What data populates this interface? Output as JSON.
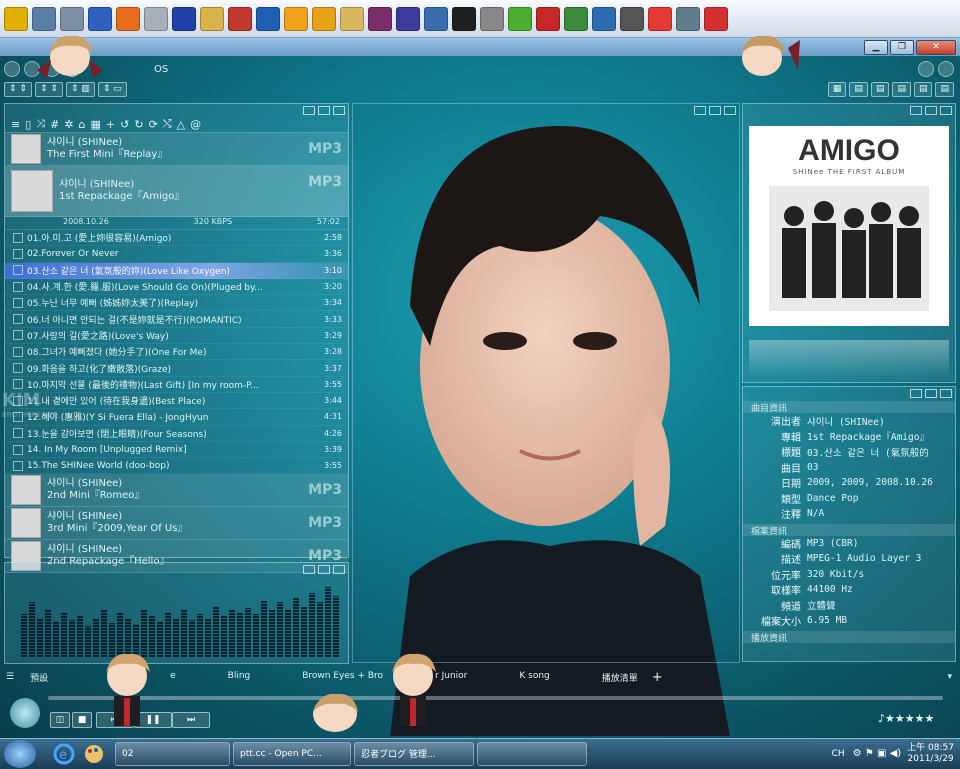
{
  "launcher": {
    "icons": [
      {
        "name": "ptt-icon",
        "color": "#e2b000"
      },
      {
        "name": "notepad-icon",
        "color": "#5a7fa6"
      },
      {
        "name": "tool-icon",
        "color": "#7d8fa4"
      },
      {
        "name": "calendar-icon",
        "color": "#2f5fbf"
      },
      {
        "name": "firefox-icon",
        "color": "#e86c1a"
      },
      {
        "name": "alien-icon",
        "color": "#a8b0b8"
      },
      {
        "name": "music-icon",
        "color": "#2340a8"
      },
      {
        "name": "paint-icon",
        "color": "#d9b24a"
      },
      {
        "name": "calendar25-icon",
        "color": "#c0392b"
      },
      {
        "name": "virtualbox-icon",
        "color": "#1f5fb4"
      },
      {
        "name": "moon-icon",
        "color": "#f0a31a"
      },
      {
        "name": "flashget-icon",
        "color": "#e8a317"
      },
      {
        "name": "folder-icon",
        "color": "#d8b75e"
      },
      {
        "name": "winrar-icon",
        "color": "#7b2d6a"
      },
      {
        "name": "player-icon",
        "color": "#3e3a9c"
      },
      {
        "name": "calculator-icon",
        "color": "#3a6db0"
      },
      {
        "name": "7zip-icon",
        "color": "#1f1f1f"
      },
      {
        "name": "edit-icon",
        "color": "#888888"
      },
      {
        "name": "heart-icon",
        "color": "#4caf2f"
      },
      {
        "name": "stop-icon",
        "color": "#c62828"
      },
      {
        "name": "clock-icon",
        "color": "#3d8b3d"
      },
      {
        "name": "transfer-icon",
        "color": "#2b6cb0"
      },
      {
        "name": "film-icon",
        "color": "#555555"
      },
      {
        "name": "color-icon",
        "color": "#e53935"
      },
      {
        "name": "drive-icon",
        "color": "#607d8b"
      },
      {
        "name": "eraser-icon",
        "color": "#d32f2f"
      }
    ]
  },
  "window": {
    "minimize": "▁",
    "restore": "❐",
    "close": "✕"
  },
  "player": {
    "menu_text": "OS"
  },
  "playlist": {
    "albums_top": [
      {
        "artist": "샤이니 (SHINee)",
        "title": "The First Mini『Replay』",
        "format": "MP3"
      }
    ],
    "current_album": {
      "artist": "샤이니 (SHINee)",
      "title": "1st Repackage『Amigo』",
      "format": "MP3",
      "date": "2008.10.26",
      "bitrate": "320 KBPS",
      "total": "57:02"
    },
    "tracks": [
      {
        "name": "01.아.미.고 (愛上妳很容易)(Amigo)",
        "dur": "2:58"
      },
      {
        "name": "02.Forever Or Never",
        "dur": "3:36"
      },
      {
        "name": "03.산소 같은 너 (氣氛般的妳)(Love Like Oxygen)",
        "dur": "3:10",
        "selected": true
      },
      {
        "name": "04.사.계.한 (愛.羅.服)(Love Should Go On)(Pluged by...",
        "dur": "3:20"
      },
      {
        "name": "05.누난 너무 예뻐 (姊姊妳太美了)(Replay)",
        "dur": "3:34"
      },
      {
        "name": "06.너 아니면 안되는 걸(不是妳就是不行)(ROMANTIC)",
        "dur": "3:33"
      },
      {
        "name": "07.사랑의 길(愛之路)(Love's Way)",
        "dur": "3:29"
      },
      {
        "name": "08.그녀가 예뻐졌다 (她分手了)(One For Me)",
        "dur": "3:28"
      },
      {
        "name": "09.화음을 하고(化了嫩散落)(Graze)",
        "dur": "3:37"
      },
      {
        "name": "10.마지막 선물 (最後的禮物)(Last Gift) [In my room-P...",
        "dur": "3:55"
      },
      {
        "name": "11.내 곁에만 있어 (待在我身邊)(Best Place)",
        "dur": "3:44"
      },
      {
        "name": "12.혜야 (惠雅)(Y Si Fuera Ella) - JongHyun",
        "dur": "4:31"
      },
      {
        "name": "13.눈을 감아보면 (閉上眼睛)(Four Seasons)",
        "dur": "4:26"
      },
      {
        "name": "14. In My Room [Unplugged Remix]",
        "dur": "3:39"
      },
      {
        "name": "15.The SHINee World (doo-bop)",
        "dur": "3:55"
      }
    ],
    "albums_bottom": [
      {
        "artist": "샤이니 (SHINee)",
        "title": "2nd Mini『Romeo』",
        "format": "MP3"
      },
      {
        "artist": "샤이니 (SHINee)",
        "title": "3rd Mini『2009,Year Of Us』",
        "format": "MP3"
      },
      {
        "artist": "샤이니 (SHINee)",
        "title": "2nd Repackage『Hello』",
        "format": "MP3"
      }
    ]
  },
  "watermark": {
    "text": "KIM",
    "sub": "BROTHERS.NET"
  },
  "spectrum": {
    "levels": [
      0.55,
      0.7,
      0.5,
      0.62,
      0.45,
      0.58,
      0.48,
      0.52,
      0.4,
      0.5,
      0.6,
      0.44,
      0.56,
      0.5,
      0.42,
      0.6,
      0.52,
      0.46,
      0.58,
      0.5,
      0.62,
      0.48,
      0.55,
      0.5,
      0.66,
      0.52,
      0.6,
      0.58,
      0.63,
      0.55,
      0.72,
      0.6,
      0.7,
      0.62,
      0.76,
      0.64,
      0.82,
      0.7,
      0.9,
      0.78
    ]
  },
  "cover": {
    "title": "AMIGO",
    "subtitle": "SHINee THE FIRST ALBUM"
  },
  "info": {
    "section1": "曲目資訊",
    "rows1": [
      {
        "k": "演出者",
        "v": "샤이니 (SHINee)"
      },
      {
        "k": "專輯",
        "v": "1st Repackage『Amigo』"
      },
      {
        "k": "標題",
        "v": "03.산소 같은 너 (氣氛般的"
      },
      {
        "k": "曲目",
        "v": "03"
      },
      {
        "k": "日期",
        "v": "2009, 2009, 2008.10.26"
      },
      {
        "k": "類型",
        "v": "Dance Pop"
      },
      {
        "k": "注釋",
        "v": "N/A"
      }
    ],
    "section2": "檔案資訊",
    "rows2": [
      {
        "k": "編碼",
        "v": "MP3 (CBR)"
      },
      {
        "k": "描述",
        "v": "MPEG-1 Audio Layer 3"
      },
      {
        "k": "位元率",
        "v": "320 Kbit/s"
      },
      {
        "k": "取樣率",
        "v": "44100 Hz"
      },
      {
        "k": "頻道",
        "v": "立體聲"
      },
      {
        "k": "檔案大小",
        "v": "6.95 MB"
      }
    ],
    "section3": "播放資訊"
  },
  "tabs": [
    {
      "label": "預設"
    },
    {
      "label": "e"
    },
    {
      "label": "Bling"
    },
    {
      "label": "Brown Eyes + Bro"
    },
    {
      "label": "r Junior"
    },
    {
      "label": "K song"
    },
    {
      "label": "播放清單"
    }
  ],
  "transport": {
    "stars": "♪★★★★★"
  },
  "taskbar": {
    "items": [
      {
        "label": "02"
      },
      {
        "label": "ptt.cc - Open PC..."
      },
      {
        "label": "忍者ブログ 管理..."
      },
      {
        "label": ""
      }
    ],
    "lang": "CH",
    "time": "上午 08:57",
    "date": "2011/3/29"
  }
}
